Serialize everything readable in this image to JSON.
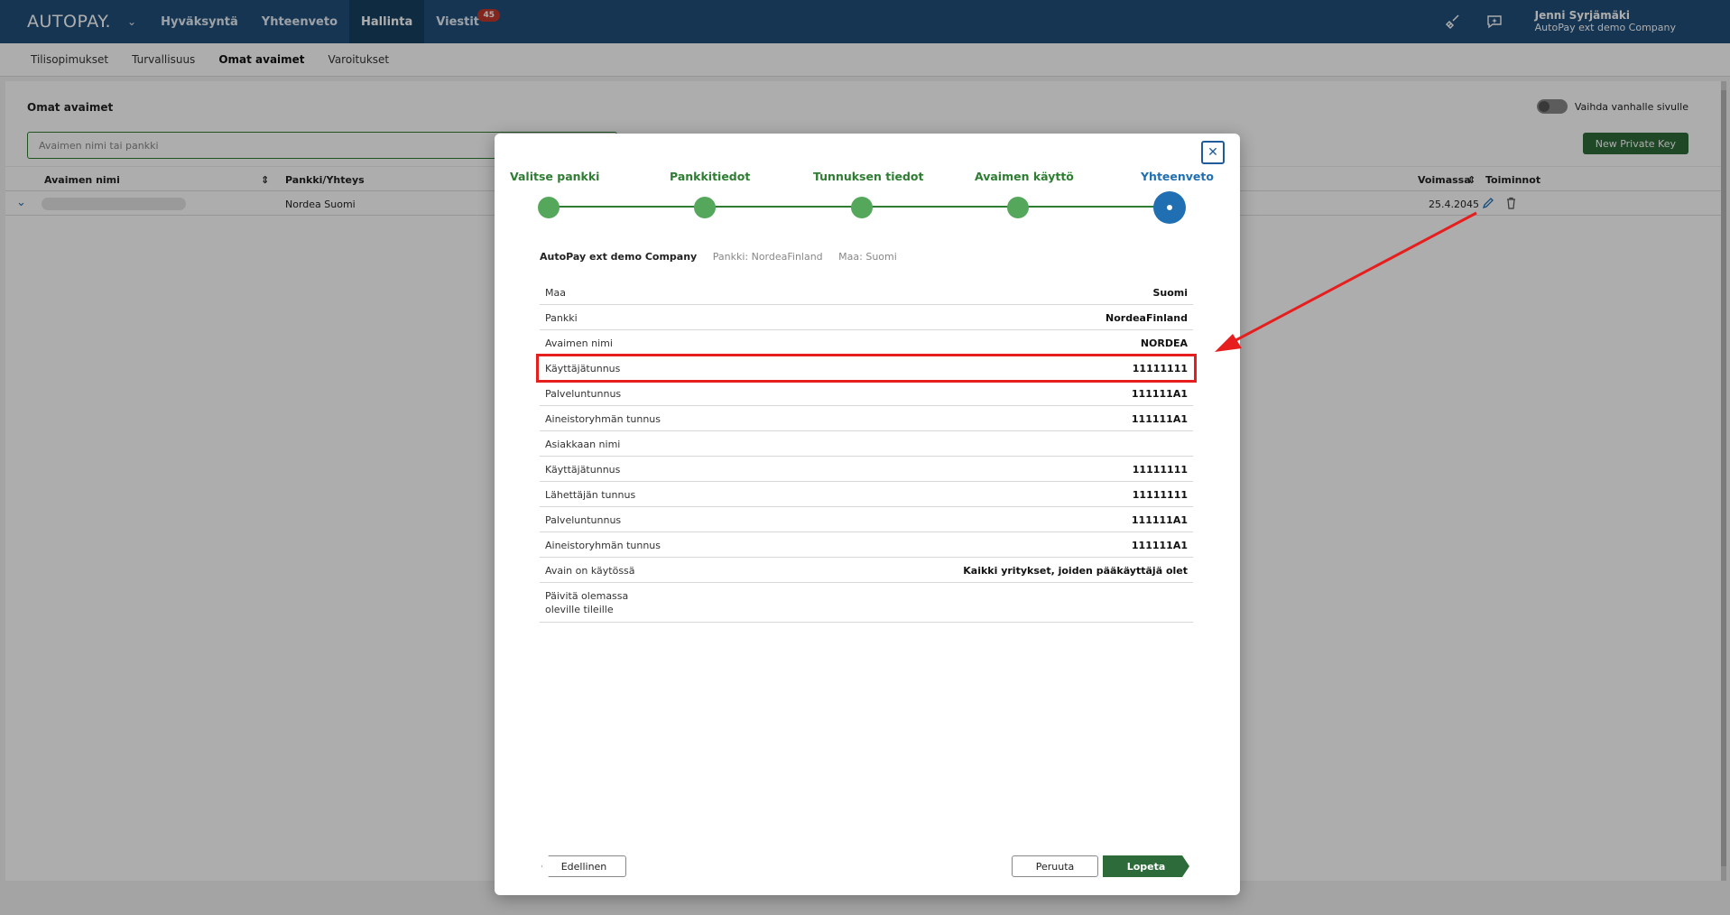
{
  "app": {
    "logo": "AUTOPAY."
  },
  "topnav": {
    "items": [
      {
        "label": "Hyväksyntä"
      },
      {
        "label": "Yhteenveto"
      },
      {
        "label": "Hallinta"
      },
      {
        "label": "Viestit"
      }
    ],
    "messages_badge": "45"
  },
  "user": {
    "name": "Jenni Syrjämäki",
    "company": "AutoPay ext demo Company"
  },
  "subnav": {
    "items": [
      {
        "label": "Tilisopimukset"
      },
      {
        "label": "Turvallisuus"
      },
      {
        "label": "Omat avaimet"
      },
      {
        "label": "Varoitukset"
      }
    ]
  },
  "page": {
    "title": "Omat avaimet",
    "toggle_label": "Vaihda vanhalle sivulle",
    "search_placeholder": "Avaimen nimi tai pankki",
    "new_key_label": "New Private Key",
    "columns": {
      "name": "Avaimen nimi",
      "bank": "Pankki/Yhteys",
      "valid": "Voimassa",
      "actions": "Toiminnot"
    },
    "row": {
      "bank": "Nordea Suomi",
      "valid": "25.4.2045"
    }
  },
  "modal": {
    "steps": [
      {
        "label": "Valitse pankki"
      },
      {
        "label": "Pankkitiedot"
      },
      {
        "label": "Tunnuksen tiedot"
      },
      {
        "label": "Avaimen käyttö"
      },
      {
        "label": "Yhteenveto"
      }
    ],
    "summary_company": "AutoPay ext demo Company",
    "summary_bank": "Pankki: NordeaFinland",
    "summary_country": "Maa: Suomi",
    "rows": [
      {
        "key": "Maa",
        "value": "Suomi"
      },
      {
        "key": "Pankki",
        "value": "NordeaFinland"
      },
      {
        "key": "Avaimen nimi",
        "value": "NORDEA"
      },
      {
        "key": "Käyttäjätunnus",
        "value": "11111111"
      },
      {
        "key": "Palveluntunnus",
        "value": "111111A1"
      },
      {
        "key": "Aineistoryhmän tunnus",
        "value": "111111A1"
      },
      {
        "key": "Asiakkaan nimi",
        "value": ""
      },
      {
        "key": "Käyttäjätunnus",
        "value": "11111111"
      },
      {
        "key": "Lähettäjän tunnus",
        "value": "11111111"
      },
      {
        "key": "Palveluntunnus",
        "value": "111111A1"
      },
      {
        "key": "Aineistoryhmän tunnus",
        "value": "111111A1"
      },
      {
        "key": "Avain on käytössä",
        "value": "Kaikki yritykset, joiden pääkäyttäjä olet"
      },
      {
        "key": "Päivitä olemassa oleville tileille",
        "value": ""
      }
    ],
    "buttons": {
      "prev": "Edellinen",
      "cancel": "Peruuta",
      "finish": "Lopeta"
    }
  },
  "colors": {
    "topbar": "#1f4e79",
    "accent_green": "#2e6b3a",
    "step_green": "#55a85b",
    "step_current": "#1f6fb2",
    "highlight": "#e61e1e"
  }
}
